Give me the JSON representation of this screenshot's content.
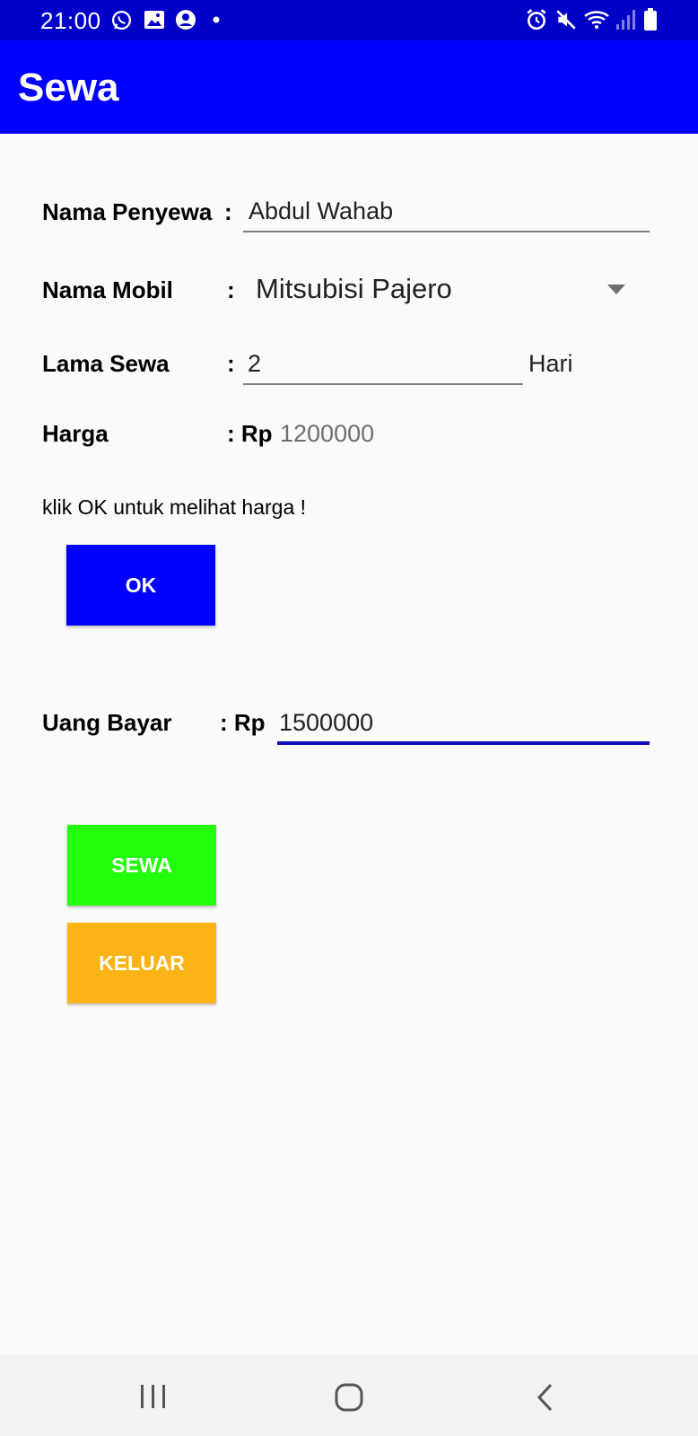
{
  "status_bar": {
    "time": "21:00",
    "icons_left": [
      "whatsapp-icon",
      "gallery-icon",
      "account-icon",
      "dot-icon"
    ],
    "icons_right": [
      "alarm-icon",
      "mute-icon",
      "wifi-icon",
      "signal-icon",
      "battery-icon"
    ]
  },
  "app_bar": {
    "title": "Sewa"
  },
  "form": {
    "nama_penyewa": {
      "label": "Nama Penyewa",
      "colon": ":",
      "value": "Abdul Wahab"
    },
    "nama_mobil": {
      "label": "Nama Mobil",
      "colon": ":",
      "selected": "Mitsubisi Pajero"
    },
    "lama_sewa": {
      "label": "Lama Sewa",
      "colon": ":",
      "value": "2",
      "unit": "Hari"
    },
    "harga": {
      "label": "Harga",
      "colon": ": Rp",
      "value": "1200000"
    },
    "hint": "klik OK untuk melihat harga !",
    "ok_label": "OK",
    "uang_bayar": {
      "label": "Uang Bayar",
      "colon": ": Rp",
      "value": "1500000"
    },
    "sewa_label": "SEWA",
    "keluar_label": "KELUAR"
  },
  "colors": {
    "status_bar": "#0000c8",
    "app_bar": "#0000ff",
    "ok_button": "#0000ff",
    "sewa_button": "#22ff0a",
    "keluar_button": "#fbb316",
    "focus_underline": "#1010b8"
  },
  "nav_bar": {
    "icons": [
      "recent-apps-icon",
      "home-icon",
      "back-icon"
    ]
  }
}
